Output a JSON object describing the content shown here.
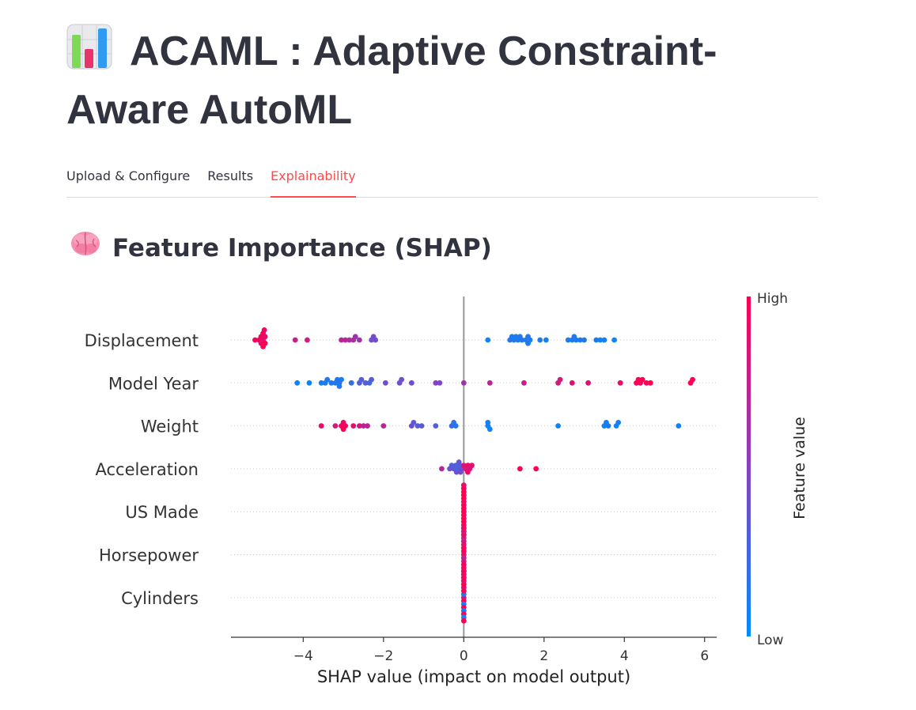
{
  "page": {
    "title": "ACAML : Adaptive Constraint-Aware AutoML",
    "title_icon": "bar-chart-icon",
    "tabs": [
      {
        "label": "Upload & Configure",
        "active": false
      },
      {
        "label": "Results",
        "active": false
      },
      {
        "label": "Explainability",
        "active": true
      }
    ],
    "subheader": "Feature Importance (SHAP)",
    "subheader_icon": "brain-icon",
    "accent_color": "#ff4b4b"
  },
  "chart_data": {
    "type": "scatter",
    "subtype": "shap-beeswarm",
    "xlabel": "SHAP value (impact on model output)",
    "xticks": [
      -4,
      -2,
      0,
      2,
      4,
      6
    ],
    "xtick_labels": [
      "−4",
      "−2",
      "0",
      "2",
      "4",
      "6"
    ],
    "xlim": [
      -5.8,
      6.3
    ],
    "colorbar": {
      "label": "Feature value",
      "high": "High",
      "low": "Low",
      "low_color": "#008bfb",
      "high_color": "#ff0052"
    },
    "features": [
      {
        "name": "Displacement",
        "points": [
          [
            -5.1,
            0.95
          ],
          [
            -5.05,
            0.95
          ],
          [
            -5.0,
            0.9
          ],
          [
            -4.97,
            0.95
          ],
          [
            -4.95,
            0.9
          ],
          [
            -5.0,
            1
          ],
          [
            -5.05,
            0.9
          ],
          [
            -5.2,
            0.95
          ],
          [
            -5.0,
            0.95
          ],
          [
            -4.95,
            1
          ],
          [
            -4.2,
            0.75
          ],
          [
            -3.9,
            0.8
          ],
          [
            -3.05,
            0.7
          ],
          [
            -2.95,
            0.7
          ],
          [
            -2.85,
            0.65
          ],
          [
            -2.75,
            0.65
          ],
          [
            -2.7,
            0.6
          ],
          [
            -2.6,
            0.6
          ],
          [
            -2.3,
            0.4
          ],
          [
            -2.25,
            0.45
          ],
          [
            -2.2,
            0.4
          ],
          [
            0.6,
            0.05
          ],
          [
            1.15,
            0.15
          ],
          [
            1.2,
            0.1
          ],
          [
            1.25,
            0.15
          ],
          [
            1.3,
            0.12
          ],
          [
            1.35,
            0.1
          ],
          [
            1.4,
            0.12
          ],
          [
            1.45,
            0.15
          ],
          [
            1.55,
            0.1
          ],
          [
            1.6,
            0.15
          ],
          [
            1.6,
            0.12
          ],
          [
            1.65,
            0.1
          ],
          [
            1.9,
            0.1
          ],
          [
            2.05,
            0.08
          ],
          [
            2.6,
            0.12
          ],
          [
            2.7,
            0.1
          ],
          [
            2.75,
            0.12
          ],
          [
            2.8,
            0.1
          ],
          [
            2.9,
            0.12
          ],
          [
            3.0,
            0.1
          ],
          [
            3.3,
            0.1
          ],
          [
            3.4,
            0.05
          ],
          [
            3.5,
            0.08
          ],
          [
            3.75,
            0.05
          ]
        ]
      },
      {
        "name": "Model Year",
        "points": [
          [
            -4.15,
            0.05
          ],
          [
            -3.85,
            0.05
          ],
          [
            -3.55,
            0.1
          ],
          [
            -3.45,
            0.1
          ],
          [
            -3.4,
            0.12
          ],
          [
            -3.3,
            0.15
          ],
          [
            -3.2,
            0.12
          ],
          [
            -3.15,
            0.1
          ],
          [
            -3.1,
            0.15
          ],
          [
            -3.1,
            0.12
          ],
          [
            -3.05,
            0.1
          ],
          [
            -2.8,
            0.2
          ],
          [
            -2.6,
            0.3
          ],
          [
            -2.55,
            0.3
          ],
          [
            -2.45,
            0.3
          ],
          [
            -2.35,
            0.25
          ],
          [
            -2.3,
            0.3
          ],
          [
            -1.95,
            0.4
          ],
          [
            -1.6,
            0.4
          ],
          [
            -1.55,
            0.4
          ],
          [
            -1.3,
            0.4
          ],
          [
            -0.7,
            0.5
          ],
          [
            -0.6,
            0.45
          ],
          [
            0.0,
            0.6
          ],
          [
            0.65,
            0.7
          ],
          [
            1.5,
            0.75
          ],
          [
            2.35,
            0.8
          ],
          [
            2.4,
            0.8
          ],
          [
            2.7,
            0.85
          ],
          [
            3.1,
            0.85
          ],
          [
            3.9,
            0.9
          ],
          [
            4.3,
            0.95
          ],
          [
            4.35,
            1
          ],
          [
            4.4,
            0.95
          ],
          [
            4.45,
            1
          ],
          [
            4.55,
            0.95
          ],
          [
            4.65,
            1
          ],
          [
            5.65,
            1
          ],
          [
            5.7,
            1
          ]
        ]
      },
      {
        "name": "Weight",
        "points": [
          [
            -3.55,
            0.9
          ],
          [
            -3.2,
            0.8
          ],
          [
            -3.05,
            0.95
          ],
          [
            -3.0,
            0.9
          ],
          [
            -3.0,
            1
          ],
          [
            -2.95,
            0.95
          ],
          [
            -2.75,
            0.85
          ],
          [
            -2.6,
            0.8
          ],
          [
            -2.5,
            0.75
          ],
          [
            -2.4,
            0.7
          ],
          [
            -2.0,
            0.7
          ],
          [
            -1.3,
            0.4
          ],
          [
            -1.25,
            0.35
          ],
          [
            -1.15,
            0.3
          ],
          [
            -1.05,
            0.35
          ],
          [
            -0.7,
            0.3
          ],
          [
            -0.3,
            0.2
          ],
          [
            -0.25,
            0.15
          ],
          [
            -0.2,
            0.15
          ],
          [
            0.6,
            0.05
          ],
          [
            0.6,
            0.08
          ],
          [
            0.65,
            0.05
          ],
          [
            2.35,
            0.05
          ],
          [
            3.5,
            0.05
          ],
          [
            3.55,
            0.08
          ],
          [
            3.6,
            0.1
          ],
          [
            3.8,
            0.05
          ],
          [
            3.85,
            0.08
          ],
          [
            5.35,
            0.05
          ]
        ]
      },
      {
        "name": "Acceleration",
        "points": [
          [
            -0.55,
            0.7
          ],
          [
            -0.35,
            0.4
          ],
          [
            -0.3,
            0.3
          ],
          [
            -0.25,
            0.35
          ],
          [
            -0.2,
            0.3
          ],
          [
            -0.18,
            0.4
          ],
          [
            -0.15,
            0.25
          ],
          [
            -0.12,
            0.35
          ],
          [
            -0.1,
            0.3
          ],
          [
            -0.08,
            0.4
          ],
          [
            -0.05,
            0.45
          ],
          [
            0.0,
            0.85
          ],
          [
            0.05,
            0.8
          ],
          [
            0.1,
            0.9
          ],
          [
            0.15,
            0.85
          ],
          [
            0.2,
            0.9
          ],
          [
            0.1,
            0.95
          ],
          [
            1.4,
            1
          ],
          [
            1.8,
            1
          ]
        ]
      },
      {
        "name": "US Made",
        "points": [
          [
            0,
            1
          ],
          [
            0,
            1
          ],
          [
            0,
            0.95
          ],
          [
            0,
            1
          ],
          [
            0,
            1
          ],
          [
            0,
            0.9
          ],
          [
            0,
            1
          ],
          [
            0,
            1
          ],
          [
            0,
            0.95
          ],
          [
            0,
            1
          ],
          [
            0,
            1
          ],
          [
            0,
            1
          ],
          [
            0,
            0.95
          ],
          [
            0,
            1
          ],
          [
            0,
            1
          ],
          [
            0,
            0.9
          ]
        ]
      },
      {
        "name": "Horsepower",
        "points": [
          [
            0,
            0.9
          ],
          [
            0,
            0.95
          ],
          [
            0,
            0.7
          ],
          [
            0,
            1
          ],
          [
            0,
            0.8
          ],
          [
            0,
            0.9
          ],
          [
            0,
            1
          ],
          [
            0,
            0.85
          ],
          [
            0,
            0.95
          ],
          [
            0,
            0.75
          ],
          [
            0,
            1
          ],
          [
            0,
            0.9
          ],
          [
            0,
            0.95
          ],
          [
            0,
            0.85
          ],
          [
            0,
            1
          ],
          [
            0,
            0.9
          ]
        ]
      },
      {
        "name": "Cylinders",
        "points": [
          [
            0,
            0.9
          ],
          [
            0,
            0.1
          ],
          [
            0,
            0.95
          ],
          [
            0,
            1
          ],
          [
            0,
            0.1
          ],
          [
            0,
            0.9
          ],
          [
            0,
            0.95
          ],
          [
            0,
            1
          ],
          [
            0,
            0.1
          ],
          [
            0,
            0.9
          ],
          [
            0,
            0.95
          ],
          [
            0,
            1
          ],
          [
            0,
            0.05
          ],
          [
            0,
            0.9
          ],
          [
            0,
            1
          ],
          [
            0,
            0.95
          ]
        ]
      }
    ]
  }
}
